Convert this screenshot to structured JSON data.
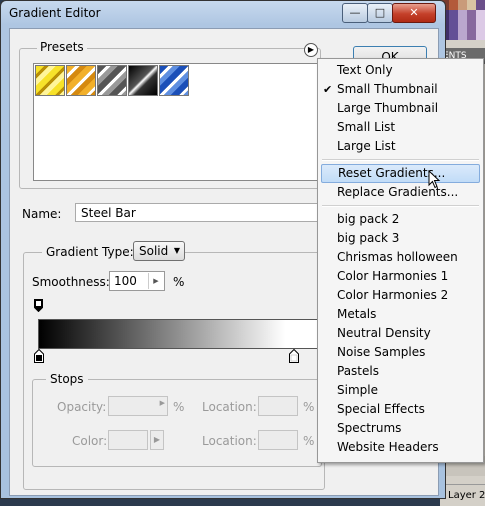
{
  "window": {
    "title": "Gradient Editor",
    "controls": {
      "minimize": "—",
      "maximize": "□",
      "close": "✕"
    }
  },
  "presets": {
    "label": "Presets",
    "swatches": [
      "gold-stripes",
      "orange-stripes",
      "gray-stripes",
      "steel-bar",
      "blue-stripes"
    ]
  },
  "buttons": {
    "ok": "OK"
  },
  "name": {
    "label": "Name:",
    "value": "Steel Bar"
  },
  "gradient": {
    "type_label": "Gradient Type:",
    "type_value": "Solid",
    "smoothness_label": "Smoothness:",
    "smoothness_value": "100",
    "smoothness_unit": "%",
    "stops": {
      "title": "Stops",
      "opacity_label": "Opacity:",
      "opacity_unit": "%",
      "location_label": "Location:",
      "color_label": "Color:",
      "location2_label": "Location:",
      "location2_unit": "%",
      "location1_unit": "%"
    }
  },
  "menu": {
    "group1": [
      "Text Only",
      "Small Thumbnail",
      "Large Thumbnail",
      "Small List",
      "Large List"
    ],
    "checked_item": "Small Thumbnail",
    "group2": [
      "Reset Gradients...",
      "Replace Gradients..."
    ],
    "highlighted_item": "Reset Gradients...",
    "group3": [
      "big pack 2",
      "big pack 3",
      "Chrismas holloween",
      "Color Harmonies 1",
      "Color Harmonies 2",
      "Metals",
      "Neutral Density",
      "Noise Samples",
      "Pastels",
      "Simple",
      "Special Effects",
      "Spectrums",
      "Website Headers"
    ]
  },
  "background": {
    "panel_tab": "ENTS",
    "layer": "Layer 2"
  },
  "colors": {
    "title_bar": "#aec6e2",
    "client": "#f0f0f0",
    "highlight": "#c1dcf7",
    "close": "#c4402a"
  }
}
